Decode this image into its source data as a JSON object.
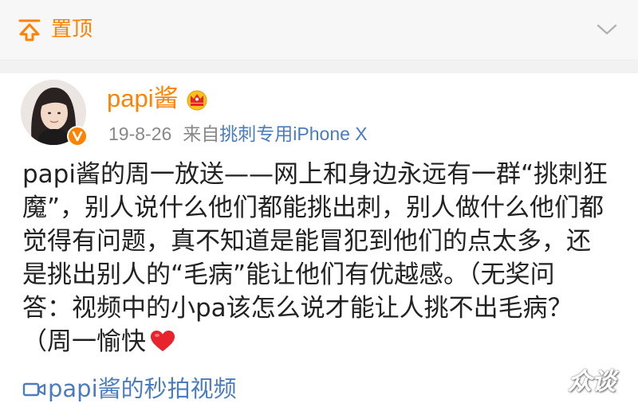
{
  "top_bar": {
    "pin_label": "置顶",
    "pin_icon": "pin-top-icon",
    "collapse_icon": "chevron-down-icon"
  },
  "post": {
    "username": "papi酱",
    "badge_icon": "crown-icon",
    "verified_icon": "verified-v-icon",
    "date": "19-8-26",
    "source_prefix": "来自",
    "source_name": "挑刺专用iPhone X",
    "text_lines": [
      "papi酱的周一放送——网上和身边永远有一群“挑刺狂",
      "魔”，别人说什么他们都能挑出刺，别人做什么他们都",
      "觉得有问题，真不知道是能冒犯到他们的点太多，还",
      "是挑出别人的“毛病”能让他们有优越感。（无奖问",
      "答：视频中的小pa该怎么说才能让人挑不出毛病？",
      "（周一愉快"
    ],
    "emoji_icon": "red-heart-icon",
    "video_link": "papi酱的秒拍视频",
    "video_icon": "video-camera-icon"
  },
  "watermark": "众谈",
  "colors": {
    "accent": "#ff8200",
    "link": "#4b7cc0",
    "meta": "#888888",
    "text": "#222222",
    "heart": "#e8232d",
    "badge": "#ff8200"
  }
}
